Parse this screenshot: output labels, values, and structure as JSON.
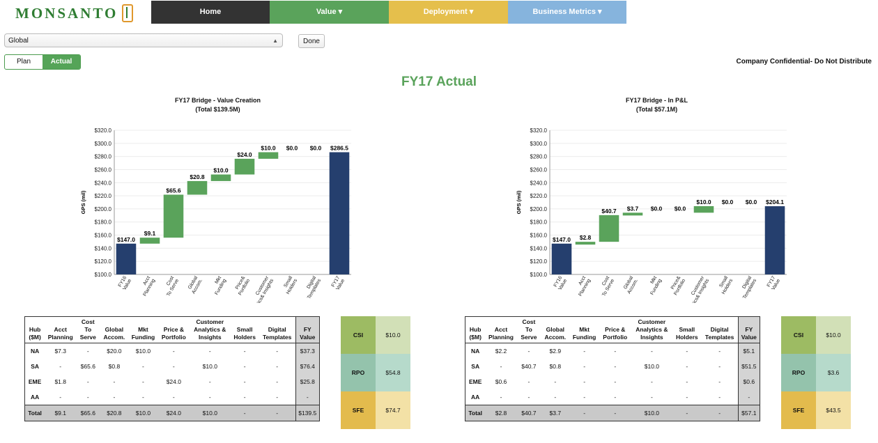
{
  "brand": {
    "name": "MONSANTO"
  },
  "nav": [
    {
      "label": "Home",
      "color": "#333333"
    },
    {
      "label": "Value ▾",
      "color": "#5aa35b"
    },
    {
      "label": "Deployment ▾",
      "color": "#e5bf4c"
    },
    {
      "label": "Business Metrics ▾",
      "color": "#86b4dd"
    }
  ],
  "controls": {
    "region": "Global",
    "done": "Done",
    "plan": "Plan",
    "actual": "Actual"
  },
  "confidential": "Company Confidential- Do Not Distribute",
  "page_title": "FY17 Actual",
  "colors": {
    "increase": "#5aa35b",
    "total": "#253f6e"
  },
  "chart_data": [
    {
      "type": "bar",
      "subtype": "waterfall",
      "title": "FY17 Bridge - Value Creation",
      "subtitle": "(Total $139.5M)",
      "ylabel": "GPS (mil)",
      "ylim": [
        100,
        320
      ],
      "yticks": [
        "$100.0",
        "$120.0",
        "$140.0",
        "$160.0",
        "$180.0",
        "$200.0",
        "$220.0",
        "$240.0",
        "$260.0",
        "$280.0",
        "$300.0",
        "$320.0"
      ],
      "categories": [
        "FY16 Value",
        "Acct Planning",
        "Cost To Serve",
        "Global Accom.",
        "Mkt Funding",
        "Price& Portfolio",
        "Customer Analytics& Insights",
        "Small Holders",
        "Digital Templates",
        "FY17 Value"
      ],
      "values": [
        147.0,
        9.1,
        65.6,
        20.8,
        10.0,
        24.0,
        10.0,
        0.0,
        0.0,
        286.5
      ],
      "labels": [
        "$147.0",
        "$9.1",
        "$65.6",
        "$20.8",
        "$10.0",
        "$24.0",
        "$10.0",
        "$0.0",
        "$0.0",
        "$286.5"
      ],
      "kinds": [
        "total",
        "step",
        "step",
        "step",
        "step",
        "step",
        "step",
        "step",
        "step",
        "total"
      ]
    },
    {
      "type": "bar",
      "subtype": "waterfall",
      "title": "FY17 Bridge - In P&L",
      "subtitle": "(Total $57.1M)",
      "ylabel": "GPS (mil)",
      "ylim": [
        100,
        320
      ],
      "yticks": [
        "$100.0",
        "$120.0",
        "$140.0",
        "$160.0",
        "$180.0",
        "$200.0",
        "$220.0",
        "$240.0",
        "$260.0",
        "$280.0",
        "$300.0",
        "$320.0"
      ],
      "categories": [
        "FY16 Value",
        "Acct Planning",
        "Cost To Serve",
        "Global Accom.",
        "Mkt Funding",
        "Price& Portfolio",
        "Customer Analytics& Insights",
        "Small Holders",
        "Digital Templates",
        "FY17 Value"
      ],
      "values": [
        147.0,
        2.8,
        40.7,
        3.7,
        0.0,
        0.0,
        10.0,
        0.0,
        0.0,
        204.1
      ],
      "labels": [
        "$147.0",
        "$2.8",
        "$40.7",
        "$3.7",
        "$0.0",
        "$0.0",
        "$10.0",
        "$0.0",
        "$0.0",
        "$204.1"
      ],
      "kinds": [
        "total",
        "step",
        "step",
        "step",
        "step",
        "step",
        "step",
        "step",
        "step",
        "total"
      ]
    }
  ],
  "tables": [
    {
      "headers": [
        "Hub ($M)",
        "Acct Planning",
        "Cost To Serve",
        "Global Accom.",
        "Mkt Funding",
        "Price & Portfolio",
        "Customer Analytics & Insights",
        "Small Holders",
        "Digital Templates",
        "FY Value"
      ],
      "rows": [
        [
          "NA",
          "$7.3",
          "-",
          "$20.0",
          "$10.0",
          "-",
          "-",
          "-",
          "-",
          "$37.3"
        ],
        [
          "SA",
          "-",
          "$65.6",
          "$0.8",
          "-",
          "-",
          "$10.0",
          "-",
          "-",
          "$76.4"
        ],
        [
          "EME",
          "$1.8",
          "-",
          "-",
          "-",
          "$24.0",
          "-",
          "-",
          "-",
          "$25.8"
        ],
        [
          "AA",
          "-",
          "-",
          "-",
          "-",
          "-",
          "-",
          "-",
          "-",
          "-"
        ],
        [
          "Total",
          "$9.1",
          "$65.6",
          "$20.8",
          "$10.0",
          "$24.0",
          "$10.0",
          "-",
          "-",
          "$139.5"
        ]
      ]
    },
    {
      "headers": [
        "Hub ($M)",
        "Acct Planning",
        "Cost To Serve",
        "Global Accom.",
        "Mkt Funding",
        "Price & Portfolio",
        "Customer Analytics & Insights",
        "Small Holders",
        "Digital Templates",
        "FY Value"
      ],
      "rows": [
        [
          "NA",
          "$2.2",
          "-",
          "$2.9",
          "-",
          "-",
          "-",
          "-",
          "-",
          "$5.1"
        ],
        [
          "SA",
          "-",
          "$40.7",
          "$0.8",
          "-",
          "-",
          "$10.0",
          "-",
          "-",
          "$51.5"
        ],
        [
          "EME",
          "$0.6",
          "-",
          "-",
          "-",
          "-",
          "-",
          "-",
          "-",
          "$0.6"
        ],
        [
          "AA",
          "-",
          "-",
          "-",
          "-",
          "-",
          "-",
          "-",
          "-",
          "-"
        ],
        [
          "Total",
          "$2.8",
          "$40.7",
          "$3.7",
          "-",
          "-",
          "$10.0",
          "-",
          "-",
          "$57.1"
        ]
      ]
    }
  ],
  "metrics": [
    [
      {
        "key": "CSI",
        "value": "$10.0",
        "kcolor": "#9dbb63",
        "vcolor": "#d2e0b7"
      },
      {
        "key": "RPO",
        "value": "$54.8",
        "kcolor": "#94c3ac",
        "vcolor": "#b6dacb"
      },
      {
        "key": "SFE",
        "value": "$74.7",
        "kcolor": "#e3bb4d",
        "vcolor": "#f3e1a6"
      }
    ],
    [
      {
        "key": "CSI",
        "value": "$10.0",
        "kcolor": "#9dbb63",
        "vcolor": "#d2e0b7"
      },
      {
        "key": "RPO",
        "value": "$3.6",
        "kcolor": "#94c3ac",
        "vcolor": "#b6dacb"
      },
      {
        "key": "SFE",
        "value": "$43.5",
        "kcolor": "#e3bb4d",
        "vcolor": "#f3e1a6"
      }
    ]
  ]
}
